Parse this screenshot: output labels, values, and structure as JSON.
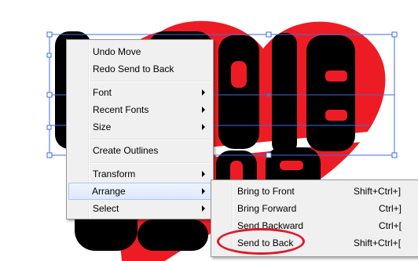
{
  "artwork": {
    "line1": "HIPPIE",
    "line2": "LOVE",
    "colors": {
      "heart": "#ed1c24",
      "text": "#000000",
      "selection": "#3b6ee0"
    }
  },
  "context_menu": {
    "items": [
      {
        "label": "Undo Move"
      },
      {
        "label": "Redo Send to Back"
      },
      {
        "label": "Font"
      },
      {
        "label": "Recent Fonts"
      },
      {
        "label": "Size"
      },
      {
        "label": "Create Outlines"
      },
      {
        "label": "Transform"
      },
      {
        "label": "Arrange"
      },
      {
        "label": "Select"
      }
    ]
  },
  "arrange_submenu": {
    "items": [
      {
        "label": "Bring to Front",
        "shortcut": "Shift+Ctrl+]"
      },
      {
        "label": "Bring Forward",
        "shortcut": "Ctrl+]"
      },
      {
        "label": "Send Backward",
        "shortcut": "Ctrl+["
      },
      {
        "label": "Send to Back",
        "shortcut": "Shift+Ctrl+["
      }
    ]
  },
  "colors": {
    "menu_bg": "#f0f0f0",
    "highlight": "#dce9fb",
    "annotation": "#e0192a"
  }
}
